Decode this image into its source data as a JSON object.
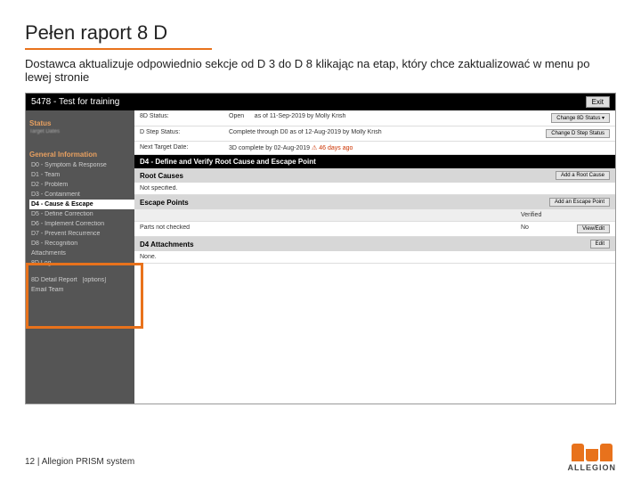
{
  "slide": {
    "title": "Pełen raport 8 D",
    "desc": "Dostawca aktualizuje odpowiednio sekcje od D 3 do D 8 klikając na etap, który chce zaktualizować w menu po lewej stronie",
    "footer": "12 | Allegion PRISM system",
    "logo": "ALLEGION"
  },
  "app": {
    "header": "5478 - Test for training",
    "exit": "Exit",
    "sidebar": {
      "status_heading": "Status",
      "status_sub": "Target Dates",
      "gen_heading": "General Information",
      "items": [
        "D0 - Symptom & Response",
        "D1 - Team",
        "D2 - Problem",
        "D3 - Containment",
        "D4 - Cause & Escape",
        "D5 - Define Correction",
        "D6 - Implement Correction",
        "D7 - Prevent Recurrence",
        "D8 - Recognition"
      ],
      "attachments": "Attachments",
      "log": "8D Log",
      "report": "8D Detail Report",
      "options": "[options]",
      "email": "Email Team"
    },
    "status": {
      "bd_status_label": "8D Status:",
      "bd_status_value": "Open",
      "bd_status_by": "as of 11-Sep-2019 by Molly Krish",
      "change_status": "Change 8D Status ▾",
      "dstep_label": "D Step Status:",
      "dstep_value": "Complete through D0  as of 12-Aug-2019 by Molly Krish",
      "change_dstep": "Change D Step Status",
      "next_label": "Next Target Date:",
      "next_value": "3D complete by 02-Aug-2019",
      "warn": "⚠ 46 days ago"
    },
    "d4": {
      "title": "D4 - Define and Verify Root Cause and Escape Point",
      "root_causes": "Root Causes",
      "add_root": "Add a Root Cause",
      "not_specified": "Not specified.",
      "escape_points": "Escape Points",
      "add_escape": "Add an Escape Point",
      "verified": "Verified",
      "row1": "Parts not checked",
      "row1_verified": "No",
      "viewedit": "View/Edit",
      "attachments": "D4 Attachments",
      "edit": "Edit",
      "none": "None."
    }
  }
}
